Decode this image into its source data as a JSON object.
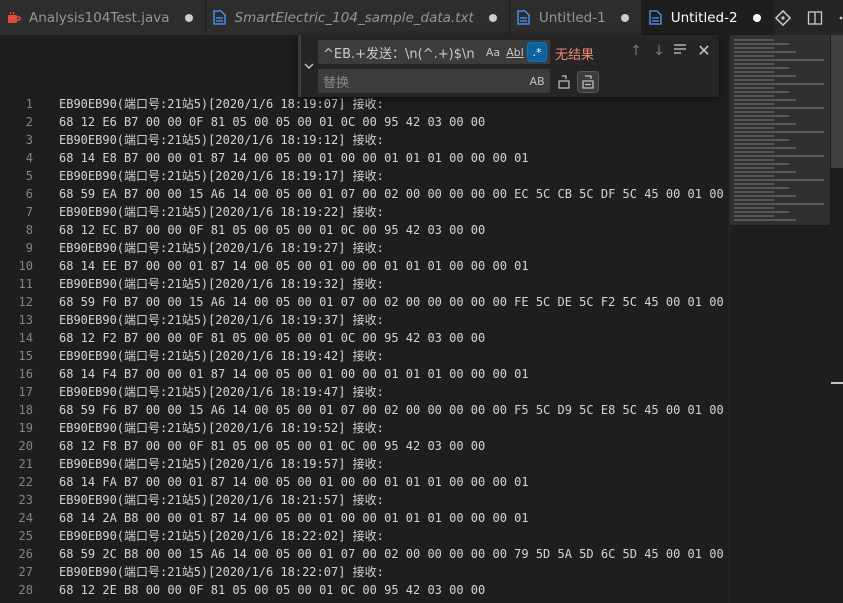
{
  "tabs": [
    {
      "label": "Analysis104Test.java",
      "italic": false,
      "active": false,
      "icon": "java-cup-icon"
    },
    {
      "label": "SmartElectric_104_sample_data.txt",
      "italic": true,
      "active": false,
      "icon": "file-icon"
    },
    {
      "label": "Untitled-1",
      "italic": false,
      "active": false,
      "icon": "file-icon"
    },
    {
      "label": "Untitled-2",
      "italic": false,
      "active": true,
      "icon": "file-icon"
    }
  ],
  "find": {
    "query": "^EB.+发送：\\n(^.+)$\\n",
    "match_case": "Aa",
    "whole_word": "Abl",
    "regex": ".*",
    "status": "无结果",
    "replace_placeholder": "替换",
    "preserve_case": "AB"
  },
  "lines": [
    {
      "n": "1",
      "text": "EB90EB90(端口号:21站5)[2020/1/6 18:19:07] 接收:"
    },
    {
      "n": "2",
      "text": "68 12 E6 B7 00 00 0F 81 05 00 05 00 01 0C 00 95 42 03 00 00"
    },
    {
      "n": "3",
      "text": "EB90EB90(端口号:21站5)[2020/1/6 18:19:12] 接收:"
    },
    {
      "n": "4",
      "text": "68 14 E8 B7 00 00 01 87 14 00 05 00 01 00 00 01 01 01 00 00 00 01"
    },
    {
      "n": "5",
      "text": "EB90EB90(端口号:21站5)[2020/1/6 18:19:17] 接收:"
    },
    {
      "n": "6",
      "text": "68 59 EA B7 00 00 15 A6 14 00 05 00 01 07 00 02 00 00 00 00 00 EC 5C CB 5C DF 5C 45 00 01 00"
    },
    {
      "n": "7",
      "text": "EB90EB90(端口号:21站5)[2020/1/6 18:19:22] 接收:"
    },
    {
      "n": "8",
      "text": "68 12 EC B7 00 00 0F 81 05 00 05 00 01 0C 00 95 42 03 00 00"
    },
    {
      "n": "9",
      "text": "EB90EB90(端口号:21站5)[2020/1/6 18:19:27] 接收:"
    },
    {
      "n": "10",
      "text": "68 14 EE B7 00 00 01 87 14 00 05 00 01 00 00 01 01 01 00 00 00 01"
    },
    {
      "n": "11",
      "text": "EB90EB90(端口号:21站5)[2020/1/6 18:19:32] 接收:"
    },
    {
      "n": "12",
      "text": "68 59 F0 B7 00 00 15 A6 14 00 05 00 01 07 00 02 00 00 00 00 00 FE 5C DE 5C F2 5C 45 00 01 00"
    },
    {
      "n": "13",
      "text": "EB90EB90(端口号:21站5)[2020/1/6 18:19:37] 接收:"
    },
    {
      "n": "14",
      "text": "68 12 F2 B7 00 00 0F 81 05 00 05 00 01 0C 00 95 42 03 00 00"
    },
    {
      "n": "15",
      "text": "EB90EB90(端口号:21站5)[2020/1/6 18:19:42] 接收:"
    },
    {
      "n": "16",
      "text": "68 14 F4 B7 00 00 01 87 14 00 05 00 01 00 00 01 01 01 00 00 00 01"
    },
    {
      "n": "17",
      "text": "EB90EB90(端口号:21站5)[2020/1/6 18:19:47] 接收:"
    },
    {
      "n": "18",
      "text": "68 59 F6 B7 00 00 15 A6 14 00 05 00 01 07 00 02 00 00 00 00 00 F5 5C D9 5C E8 5C 45 00 01 00"
    },
    {
      "n": "19",
      "text": "EB90EB90(端口号:21站5)[2020/1/6 18:19:52] 接收:"
    },
    {
      "n": "20",
      "text": "68 12 F8 B7 00 00 0F 81 05 00 05 00 01 0C 00 95 42 03 00 00"
    },
    {
      "n": "21",
      "text": "EB90EB90(端口号:21站5)[2020/1/6 18:19:57] 接收:"
    },
    {
      "n": "22",
      "text": "68 14 FA B7 00 00 01 87 14 00 05 00 01 00 00 01 01 01 00 00 00 01"
    },
    {
      "n": "23",
      "text": "EB90EB90(端口号:21站5)[2020/1/6 18:21:57] 接收:"
    },
    {
      "n": "24",
      "text": "68 14 2A B8 00 00 01 87 14 00 05 00 01 00 00 01 01 01 00 00 00 01"
    },
    {
      "n": "25",
      "text": "EB90EB90(端口号:21站5)[2020/1/6 18:22:02] 接收:"
    },
    {
      "n": "26",
      "text": "68 59 2C B8 00 00 15 A6 14 00 05 00 01 07 00 02 00 00 00 00 00 79 5D 5A 5D 6C 5D 45 00 01 00"
    },
    {
      "n": "27",
      "text": "EB90EB90(端口号:21站5)[2020/1/6 18:22:07] 接收:"
    },
    {
      "n": "28",
      "text": "68 12 2E B8 00 00 0F 81 05 00 05 00 01 0C 00 95 42 03 00 00"
    }
  ]
}
